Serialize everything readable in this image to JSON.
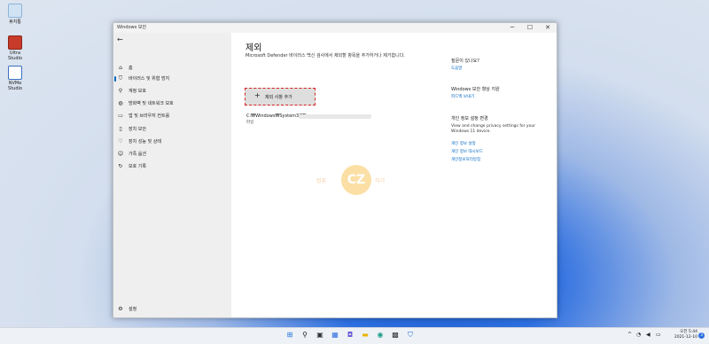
{
  "desktop": {
    "icons": [
      {
        "label": "휴지통"
      },
      {
        "label": "Ultra Studio"
      },
      {
        "label": "NVMe Studio"
      }
    ]
  },
  "window": {
    "title": "Windows 보안",
    "controls": {
      "minimize": "─",
      "maximize": "☐",
      "close": "✕"
    }
  },
  "nav": {
    "back_icon": "←",
    "items": [
      {
        "icon": "⌂",
        "label": "홈"
      },
      {
        "icon": "⛉",
        "label": "바이러스 및 위협 방지"
      },
      {
        "icon": "⚲",
        "label": "계정 보호"
      },
      {
        "icon": "◍",
        "label": "방화벽 및 네트워크 보호"
      },
      {
        "icon": "▭",
        "label": "앱 및 브라우저 컨트롤"
      },
      {
        "icon": "▯",
        "label": "장치 보안"
      },
      {
        "icon": "♡",
        "label": "장치 성능 및 상태"
      },
      {
        "icon": "☺",
        "label": "가족 옵션"
      },
      {
        "icon": "↻",
        "label": "보호 기록"
      }
    ],
    "settings": {
      "icon": "⚙",
      "label": "설정"
    }
  },
  "main": {
    "title": "제외",
    "description": "Microsoft Defender 바이러스 백신 검사에서 제외할 항목을 추가하거나 제거합니다.",
    "add_button": {
      "icon": "+",
      "label": "제외 사항 추가"
    },
    "exclusion": {
      "path": "C:₩Windows₩System32₩",
      "type": "파일"
    }
  },
  "side": {
    "help_heading": "질문이 있나요?",
    "help_link": "도움말",
    "improve_heading": "Windows 보안 향상 지원",
    "feedback_link": "피드백 보내기",
    "privacy_heading": "개인 정보 설정 변경",
    "privacy_text": "View and change privacy settings for your Windows 11 device.",
    "privacy_links": [
      "개인 정보 설정",
      "개인 정보 대시보드",
      "개인정보처리방침"
    ]
  },
  "watermark": {
    "logo": "CZ",
    "left_text": "컴퓨",
    "right_text": "하기"
  },
  "taskbar": {
    "apps": [
      {
        "icon": "windows-start-icon",
        "glyph": "⊞",
        "color": "#1a6fd8"
      },
      {
        "icon": "search-icon",
        "glyph": "⚲",
        "color": "#222222"
      },
      {
        "icon": "task-view-icon",
        "glyph": "▣",
        "color": "#333333"
      },
      {
        "icon": "widgets-icon",
        "glyph": "▦",
        "color": "#2d6fe0"
      },
      {
        "icon": "chat-icon",
        "glyph": "◘",
        "color": "#6b5ad6"
      },
      {
        "icon": "file-explorer-icon",
        "glyph": "▬",
        "color": "#e8b400"
      },
      {
        "icon": "edge-icon",
        "glyph": "◉",
        "color": "#1b9e8a"
      },
      {
        "icon": "store-icon",
        "glyph": "▩",
        "color": "#333333"
      },
      {
        "icon": "security-icon",
        "glyph": "⛉",
        "color": "#1a6fd8"
      }
    ],
    "tray": {
      "chevron": "^",
      "network": "◔",
      "volume": "◀",
      "battery": "▭"
    },
    "time": "오전 5:44",
    "date": "2021-12-10",
    "notification_count": "3"
  }
}
